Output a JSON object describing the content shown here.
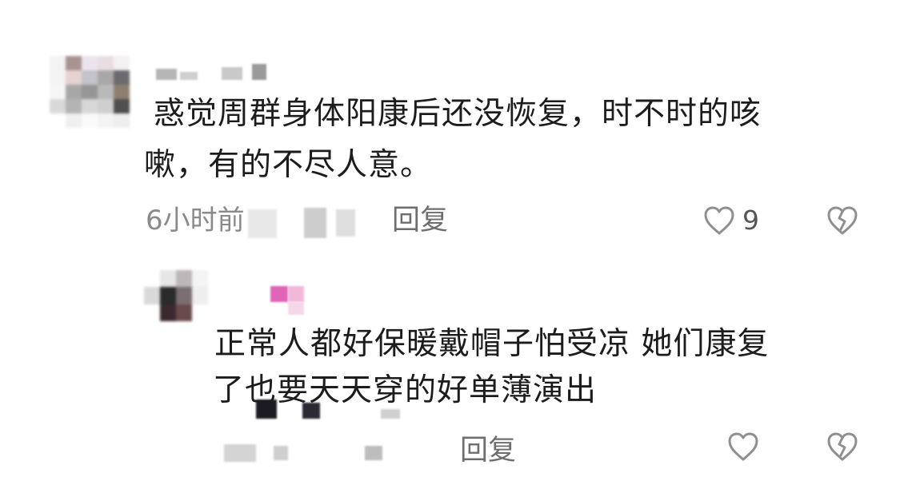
{
  "comments": [
    {
      "text_lines": [
        "惑觉周群身体阳康后还没恢复，时不时的咳",
        "嗽，有的不尽人意。"
      ],
      "time": "6小时前",
      "reply_label": "回复",
      "like_count": "9",
      "like_icon": "heart-outline-icon",
      "dislike_icon": "broken-heart-icon"
    },
    {
      "text_lines": [
        "正常人都好保暖戴帽子怕受凉 她们康复",
        "了也要天天穿的好单薄演出"
      ],
      "reply_label": "回复",
      "like_icon": "heart-outline-icon",
      "dislike_icon": "broken-heart-icon"
    }
  ],
  "colors": {
    "text": "#1c1c1c",
    "meta": "#8a8a8a",
    "icon": "#8f8f8f",
    "background": "#ffffff"
  }
}
